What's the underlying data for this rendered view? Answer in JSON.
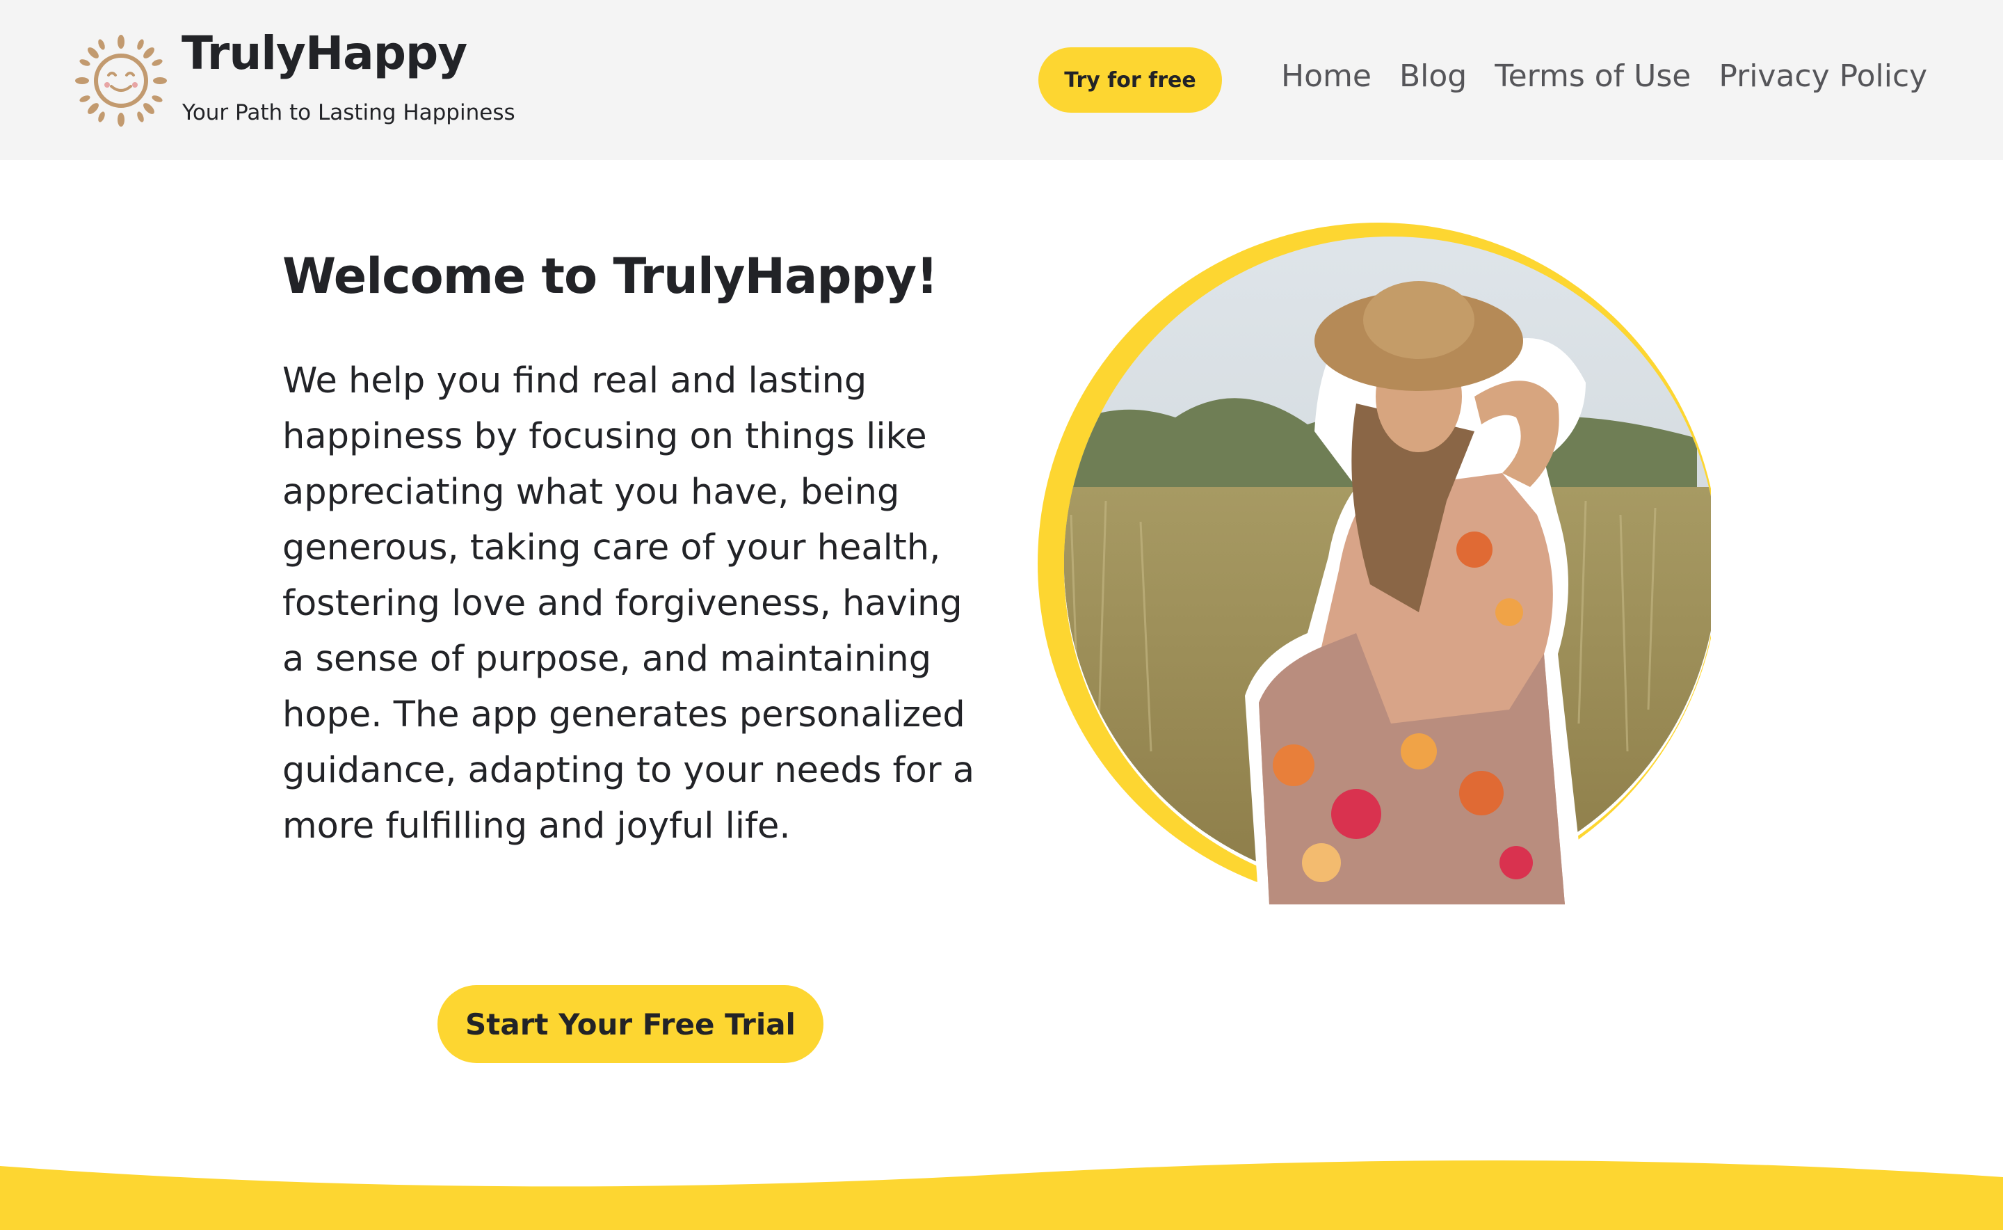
{
  "header": {
    "logo_icon": "sun-face-icon",
    "brand_name": "TrulyHappy",
    "tagline": "Your Path to Lasting Happiness",
    "try_button_label": "Try for free",
    "nav": [
      {
        "label": "Home"
      },
      {
        "label": "Blog"
      },
      {
        "label": "Terms of Use"
      },
      {
        "label": "Privacy Policy"
      }
    ]
  },
  "hero": {
    "title": "Welcome to TrulyHappy!",
    "body": "We help you find real and lasting happiness by focusing on things like appreciating what you have, being generous, taking care of your health, fostering love and forgiveness, having a sense of purpose, and maintaining hope. The app generates personalized guidance, adapting to your needs for a more fulfilling and joyful life.",
    "cta_label": "Start Your Free Trial",
    "image_subject": "woman-in-hat-field-photo"
  },
  "colors": {
    "accent_yellow": "#fdd631",
    "header_bg": "#f4f4f4",
    "text_dark": "#222327",
    "nav_text": "#555559",
    "logo_brown": "#c29a6f"
  }
}
